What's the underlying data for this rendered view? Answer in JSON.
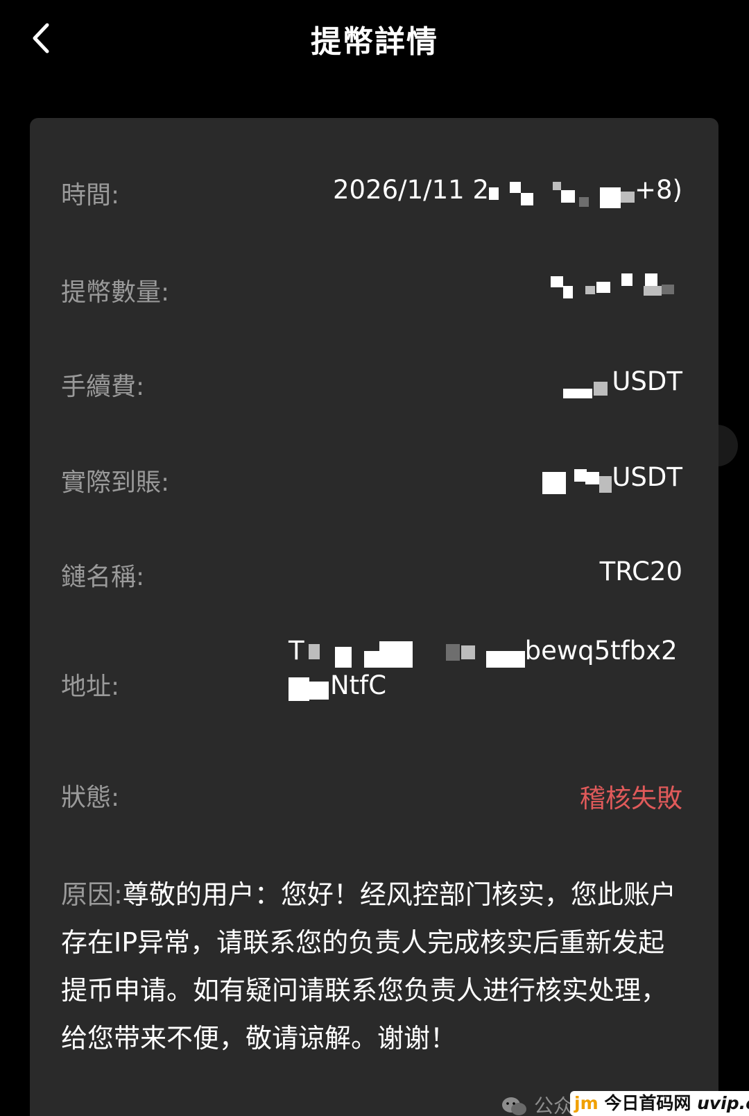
{
  "header": {
    "title": "提幣詳情"
  },
  "rows": {
    "time": {
      "label": "時間:",
      "value_prefix": "2026/1/11 2",
      "value_suffix": "+8)"
    },
    "amount": {
      "label": "提幣數量:"
    },
    "fee": {
      "label": "手續費:",
      "value_suffix": "USDT"
    },
    "received": {
      "label": "實際到賬:",
      "value_suffix": "USDT"
    },
    "chain": {
      "label": "鏈名稱:",
      "value": "TRC20"
    },
    "address": {
      "label": "地址:",
      "line1_prefix": "T",
      "line1_suffix": "bewq5tfbx2",
      "line2_suffix": "NtfC"
    },
    "status": {
      "label": "狀態:",
      "value": "稽核失敗",
      "color": "#e05a5a"
    }
  },
  "reason": {
    "label": "原因:",
    "text": "尊敬的用户：您好！经风控部门核实，您此账户存在IP异常，请联系您的负责人完成核实后重新发起提币申请。如有疑问请联系您负责人进行核实处理，给您带来不便，敬请谅解。谢谢！"
  },
  "watermark": {
    "icon": "wechat-icon",
    "text": "公众号 · 众人皆韭菜",
    "brand_jm": "jm",
    "brand_cn": "今日首码网",
    "brand_domain": "uvip.cc"
  },
  "colors": {
    "background": "#000000",
    "card": "#2a2a2a",
    "label": "#9a9a9a",
    "failed": "#e05a5a"
  }
}
